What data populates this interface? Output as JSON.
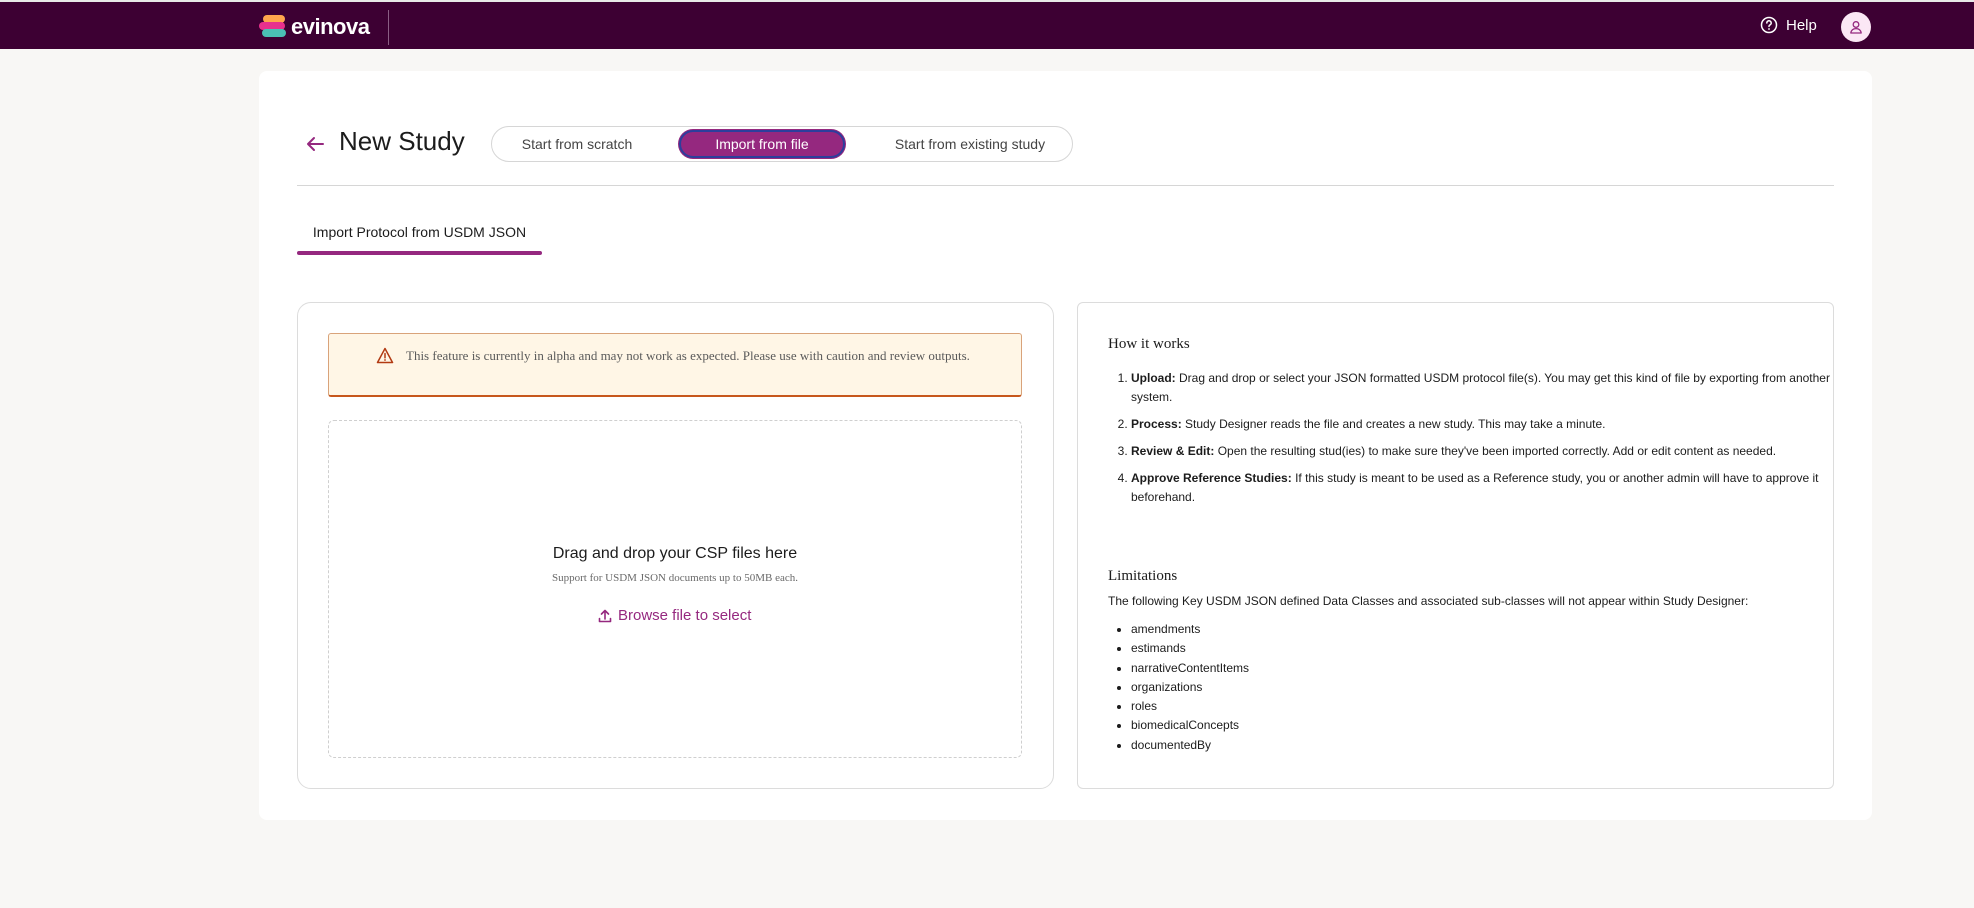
{
  "header": {
    "brand": "evinova",
    "help_label": "Help"
  },
  "page": {
    "title": "New Study",
    "mode_tabs": [
      {
        "label": "Start from scratch",
        "active": false
      },
      {
        "label": "Import from file",
        "active": true
      },
      {
        "label": "Start from existing study",
        "active": false
      }
    ],
    "sub_tab": "Import Protocol from USDM JSON"
  },
  "alert": {
    "icon": "warning-icon",
    "text": "This feature is currently in alpha and may not work as expected. Please use with caution and review outputs."
  },
  "dropzone": {
    "title": "Drag and drop your CSP files here",
    "subtitle": "Support for USDM JSON documents up to 50MB each.",
    "browse_label": "Browse file to select"
  },
  "how_it_works": {
    "title": "How it works",
    "steps": [
      {
        "label": "Upload:",
        "text": "Drag and drop or select your JSON formatted USDM protocol file(s). You may get this kind of file by exporting from another system."
      },
      {
        "label": "Process:",
        "text": "Study Designer reads the file and creates a new study. This may take a minute."
      },
      {
        "label": "Review & Edit:",
        "text": "Open the resulting stud(ies) to make sure they've been imported correctly. Add or edit content as needed."
      },
      {
        "label": "Approve Reference Studies:",
        "text": "If this study is meant to be used as a Reference study, you or another admin will have to approve it beforehand."
      }
    ]
  },
  "limitations": {
    "title": "Limitations",
    "description": "The following Key USDM JSON defined Data Classes and associated sub-classes will not appear within Study Designer:",
    "items": [
      "amendments",
      "estimands",
      "narrativeContentItems",
      "organizations",
      "roles",
      "biomedicalConcepts",
      "documentedBy"
    ]
  },
  "colors": {
    "header_bg": "#3d0033",
    "accent": "#95287f",
    "alert_bg": "#fff6e6"
  }
}
